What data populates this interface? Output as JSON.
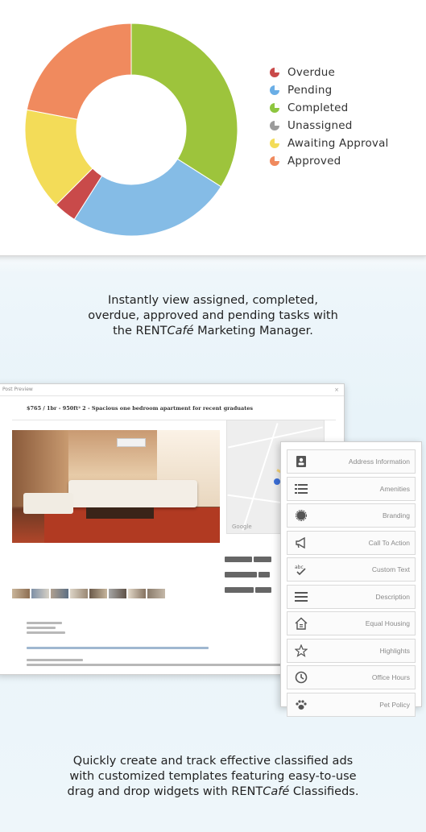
{
  "chart_data": {
    "type": "pie",
    "donut": true,
    "slices": [
      {
        "label": "Completed",
        "value": 34,
        "color": "#9dc43c"
      },
      {
        "label": "Pending",
        "value": 25,
        "color": "#85bce6"
      },
      {
        "label": "Overdue",
        "value": 3.5,
        "color": "#c94a4a"
      },
      {
        "label": "Awaiting Approval",
        "value": 15.5,
        "color": "#f3dc58"
      },
      {
        "label": "Approved",
        "value": 22,
        "color": "#f08a5e"
      }
    ],
    "legend": [
      {
        "label": "Overdue",
        "color": "#c94a4a"
      },
      {
        "label": "Pending",
        "color": "#6aaee6"
      },
      {
        "label": "Completed",
        "color": "#8ec63f"
      },
      {
        "label": "Unassigned",
        "color": "#9b9b9b"
      },
      {
        "label": "Awaiting Approval",
        "color": "#f3dc58"
      },
      {
        "label": "Approved",
        "color": "#f08a5e"
      }
    ],
    "legend_position": "right"
  },
  "captions": {
    "marketing": {
      "line1": "Instantly view assigned, completed,",
      "line2": "overdue, approved and pending tasks with",
      "line3_pre": "the RENT",
      "line3_italic": "Café",
      "line3_post": " Marketing Manager."
    },
    "classifieds": {
      "line1": "Quickly create and track effective classified ads",
      "line2": "with customized templates featuring easy-to-use",
      "line3_pre": "drag and drop widgets with RENT",
      "line3_italic": "Café",
      "line3_post": " Classifieds."
    }
  },
  "post_preview": {
    "window_title": "Post Preview",
    "close_glyph": "×",
    "heading": "$765 / 1br - 950ft² 2 - Spacious one bedroom apartment for recent graduates",
    "map_attribution": "Google"
  },
  "widgets": [
    {
      "label": "Address Information",
      "icon": "address-card-icon"
    },
    {
      "label": "Amenities",
      "icon": "list-icon"
    },
    {
      "label": "Branding",
      "icon": "stamp-icon"
    },
    {
      "label": "Call To Action",
      "icon": "megaphone-icon"
    },
    {
      "label": "Custom Text",
      "icon": "text-check-icon"
    },
    {
      "label": "Description",
      "icon": "lines-icon"
    },
    {
      "label": "Equal Housing",
      "icon": "house-icon"
    },
    {
      "label": "Highlights",
      "icon": "star-icon"
    },
    {
      "label": "Office Hours",
      "icon": "clock-icon"
    },
    {
      "label": "Pet Policy",
      "icon": "paw-icon"
    }
  ]
}
